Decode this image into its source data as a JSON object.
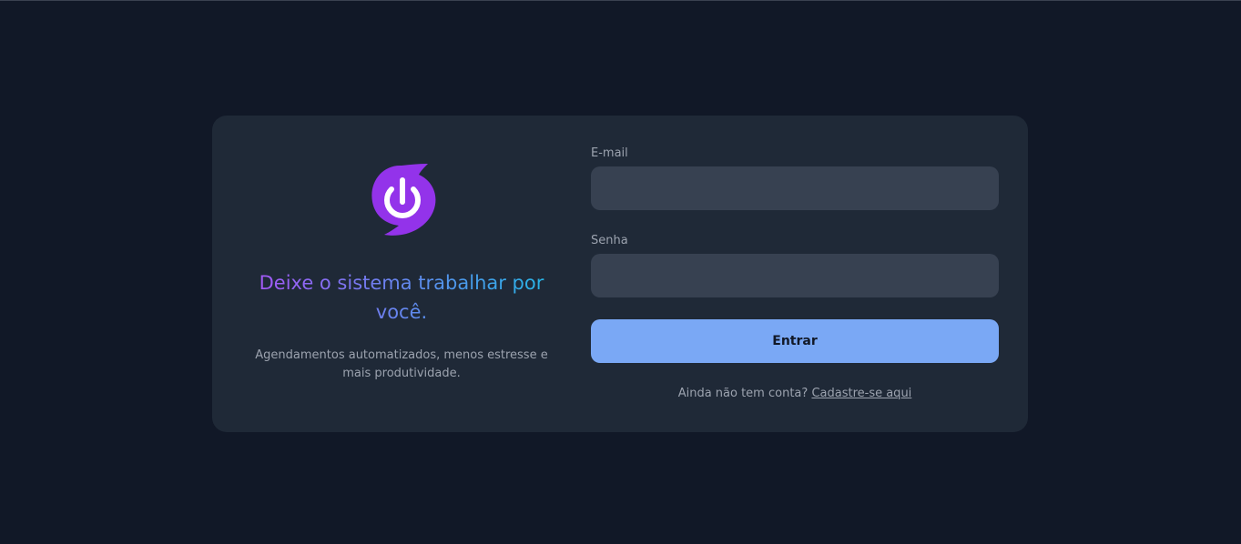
{
  "brand": {
    "logo_icon": "power-swirl-icon",
    "accent_color": "#9333ea",
    "headline": "Deixe o sistema trabalhar por você.",
    "subtext": "Agendamentos automatizados, menos estresse e mais produtividade."
  },
  "form": {
    "email_label": "E-mail",
    "email_value": "",
    "password_label": "Senha",
    "password_value": "",
    "submit_label": "Entrar",
    "signup_prompt": "Ainda não tem conta?",
    "signup_link": "Cadastre-se aqui",
    "button_color": "#7aa8f5"
  }
}
